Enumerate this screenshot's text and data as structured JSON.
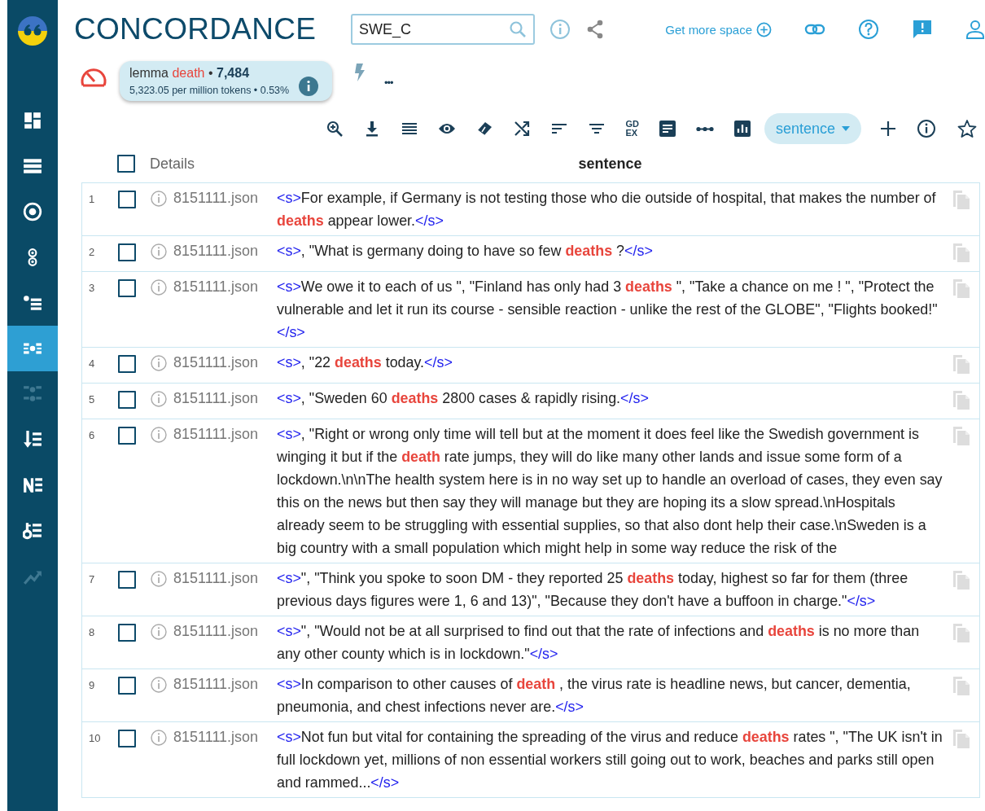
{
  "sidebar": {
    "items": [
      {
        "selected": false,
        "disabled": false
      },
      {
        "selected": false,
        "disabled": false
      },
      {
        "selected": false,
        "disabled": false
      },
      {
        "selected": false,
        "disabled": false
      },
      {
        "selected": false,
        "disabled": false
      },
      {
        "selected": true,
        "disabled": false
      },
      {
        "selected": false,
        "disabled": true
      },
      {
        "selected": false,
        "disabled": false
      },
      {
        "selected": false,
        "disabled": false
      },
      {
        "selected": false,
        "disabled": false
      },
      {
        "selected": false,
        "disabled": true
      }
    ]
  },
  "header": {
    "title": "CONCORDANCE",
    "search": {
      "value": "SWE_C"
    },
    "get_more_space": "Get more space"
  },
  "summary": {
    "label": "lemma",
    "query": "death",
    "count": "7,484",
    "frequency": "5,323.05 per million tokens",
    "percent": "0.53%",
    "separator": "•",
    "more": "•••"
  },
  "toolbar": {
    "gdex": [
      "GD",
      "EX"
    ],
    "view": "sentence"
  },
  "table": {
    "columns": [
      "Details",
      "sentence"
    ],
    "header_checked": false,
    "rows": [
      {
        "number": "1",
        "checked": false,
        "doc": "8151111.json",
        "segments": [
          {
            "kind": "tag",
            "text": "<s>"
          },
          {
            "kind": "text",
            "text": "For example, if Germany is not testing those who die outside of hospital, that makes the number of "
          },
          {
            "kind": "hit",
            "text": "deaths"
          },
          {
            "kind": "text",
            "text": " appear lower."
          },
          {
            "kind": "tag",
            "text": "</s>"
          }
        ]
      },
      {
        "number": "2",
        "checked": false,
        "doc": "8151111.json",
        "segments": [
          {
            "kind": "tag",
            "text": "<s>"
          },
          {
            "kind": "text",
            "text": ", \"What is germany doing to have so few "
          },
          {
            "kind": "hit",
            "text": "deaths"
          },
          {
            "kind": "text",
            "text": " ?"
          },
          {
            "kind": "tag",
            "text": "</s>"
          }
        ]
      },
      {
        "number": "3",
        "checked": false,
        "doc": "8151111.json",
        "segments": [
          {
            "kind": "tag",
            "text": "<s>"
          },
          {
            "kind": "text",
            "text": "We owe it to each of us \", \"Finland has only had 3 "
          },
          {
            "kind": "hit",
            "text": "deaths"
          },
          {
            "kind": "text",
            "text": " \", \"Take a chance on me ! \", \"Protect the vulnerable and let it run its course - sensible reaction - unlike the rest of the GLOBE\", \"Flights booked!\""
          },
          {
            "kind": "tag",
            "text": "</s>"
          }
        ]
      },
      {
        "number": "4",
        "checked": false,
        "doc": "8151111.json",
        "segments": [
          {
            "kind": "tag",
            "text": "<s>"
          },
          {
            "kind": "text",
            "text": ", \"22 "
          },
          {
            "kind": "hit",
            "text": "deaths"
          },
          {
            "kind": "text",
            "text": " today."
          },
          {
            "kind": "tag",
            "text": "</s>"
          }
        ]
      },
      {
        "number": "5",
        "checked": false,
        "doc": "8151111.json",
        "segments": [
          {
            "kind": "tag",
            "text": "<s>"
          },
          {
            "kind": "text",
            "text": ", \"Sweden 60 "
          },
          {
            "kind": "hit",
            "text": "deaths"
          },
          {
            "kind": "text",
            "text": " 2800 cases & rapidly rising."
          },
          {
            "kind": "tag",
            "text": "</s>"
          }
        ]
      },
      {
        "number": "6",
        "checked": false,
        "doc": "8151111.json",
        "segments": [
          {
            "kind": "tag",
            "text": "<s>"
          },
          {
            "kind": "text",
            "text": ", \"Right or wrong only time will tell but at the moment it does feel like the Swedish government is winging it but if the "
          },
          {
            "kind": "hit",
            "text": "death"
          },
          {
            "kind": "text",
            "text": " rate jumps, they will do like many other lands and issue some form of a lockdown.\\n\\nThe health system here is in no way set up to handle an overload of cases, they even say this on the news but then say they will manage but they are hoping its a slow spread.\\nHospitals already seem to be struggling with essential supplies, so that also dont help their case.\\nSweden is a big country with a small population which might help in some way reduce the risk of the"
          }
        ]
      },
      {
        "number": "7",
        "checked": false,
        "doc": "8151111.json",
        "segments": [
          {
            "kind": "tag",
            "text": "<s>"
          },
          {
            "kind": "text",
            "text": "\", \"Think you spoke to soon DM - they reported 25 "
          },
          {
            "kind": "hit",
            "text": "deaths"
          },
          {
            "kind": "text",
            "text": " today, highest so far for them (three previous days figures were 1, 6 and 13)\", \"Because they don't have a buffoon in charge.\""
          },
          {
            "kind": "tag",
            "text": "</s>"
          }
        ]
      },
      {
        "number": "8",
        "checked": false,
        "doc": "8151111.json",
        "segments": [
          {
            "kind": "tag",
            "text": "<s>"
          },
          {
            "kind": "text",
            "text": "\", \"Would not be at all surprised to find out that the rate of infections and "
          },
          {
            "kind": "hit",
            "text": "deaths"
          },
          {
            "kind": "text",
            "text": " is no more than any other county which is in lockdown.\""
          },
          {
            "kind": "tag",
            "text": "</s>"
          }
        ]
      },
      {
        "number": "9",
        "checked": false,
        "doc": "8151111.json",
        "segments": [
          {
            "kind": "tag",
            "text": "<s>"
          },
          {
            "kind": "text",
            "text": "In comparison to other causes of "
          },
          {
            "kind": "hit",
            "text": "death"
          },
          {
            "kind": "text",
            "text": " , the virus rate is headline news, but cancer, dementia, pneumonia, and chest infections never are."
          },
          {
            "kind": "tag",
            "text": "</s>"
          }
        ]
      },
      {
        "number": "10",
        "checked": false,
        "doc": "8151111.json",
        "segments": [
          {
            "kind": "tag",
            "text": "<s>"
          },
          {
            "kind": "text",
            "text": "Not fun but vital for containing the spreading of the virus and reduce "
          },
          {
            "kind": "hit",
            "text": "deaths"
          },
          {
            "kind": "text",
            "text": " rates \", \"The UK isn't in full lockdown yet, millions of non essential workers still going out to work, beaches and parks still open and rammed..."
          },
          {
            "kind": "tag",
            "text": "</s>"
          }
        ]
      }
    ]
  }
}
